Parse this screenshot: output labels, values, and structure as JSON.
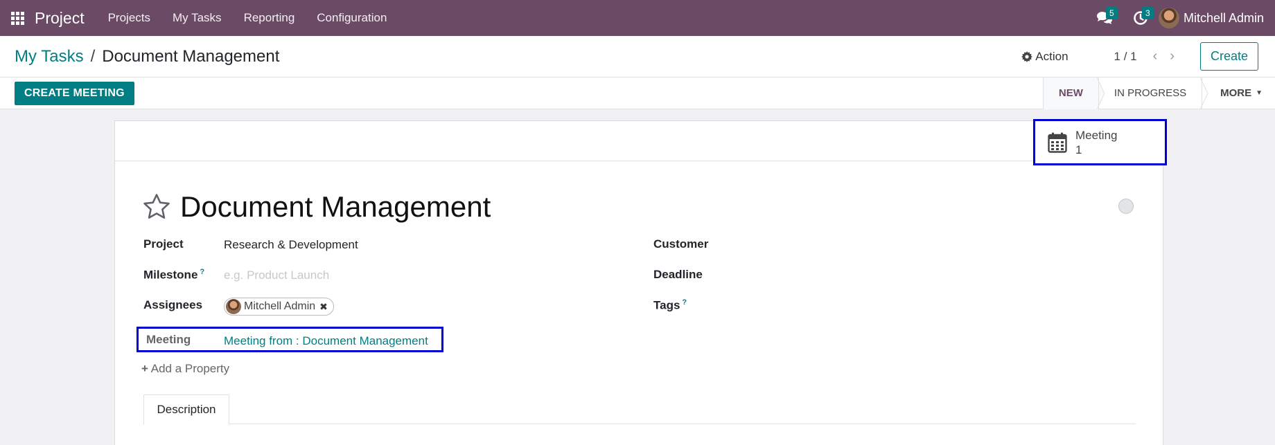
{
  "navbar": {
    "app_name": "Project",
    "menu": [
      "Projects",
      "My Tasks",
      "Reporting",
      "Configuration"
    ],
    "messages_count": "5",
    "activities_count": "3",
    "user_name": "Mitchell Admin"
  },
  "breadcrumb": {
    "parent": "My Tasks",
    "separator": "/",
    "current": "Document Management"
  },
  "control": {
    "action_label": "Action",
    "pager": "1 / 1",
    "create_label": "Create"
  },
  "statusbar": {
    "create_meeting_label": "CREATE MEETING",
    "stages": [
      "NEW",
      "IN PROGRESS",
      "MORE"
    ]
  },
  "smart_button": {
    "label": "Meeting",
    "count": "1"
  },
  "task": {
    "title": "Document Management",
    "fields": {
      "project_label": "Project",
      "project_value": "Research & Development",
      "milestone_label": "Milestone",
      "milestone_help": "?",
      "milestone_placeholder": "e.g. Product Launch",
      "assignees_label": "Assignees",
      "assignee": "Mitchell Admin",
      "customer_label": "Customer",
      "deadline_label": "Deadline",
      "tags_label": "Tags",
      "tags_help": "?",
      "meeting_label": "Meeting",
      "meeting_value": "Meeting from : Document Management"
    },
    "add_property": "Add a Property",
    "tabs": [
      "Description"
    ]
  },
  "colors": {
    "navbar": "#6b4a66",
    "accent": "#017e84",
    "highlight_box": "#0000d4"
  }
}
